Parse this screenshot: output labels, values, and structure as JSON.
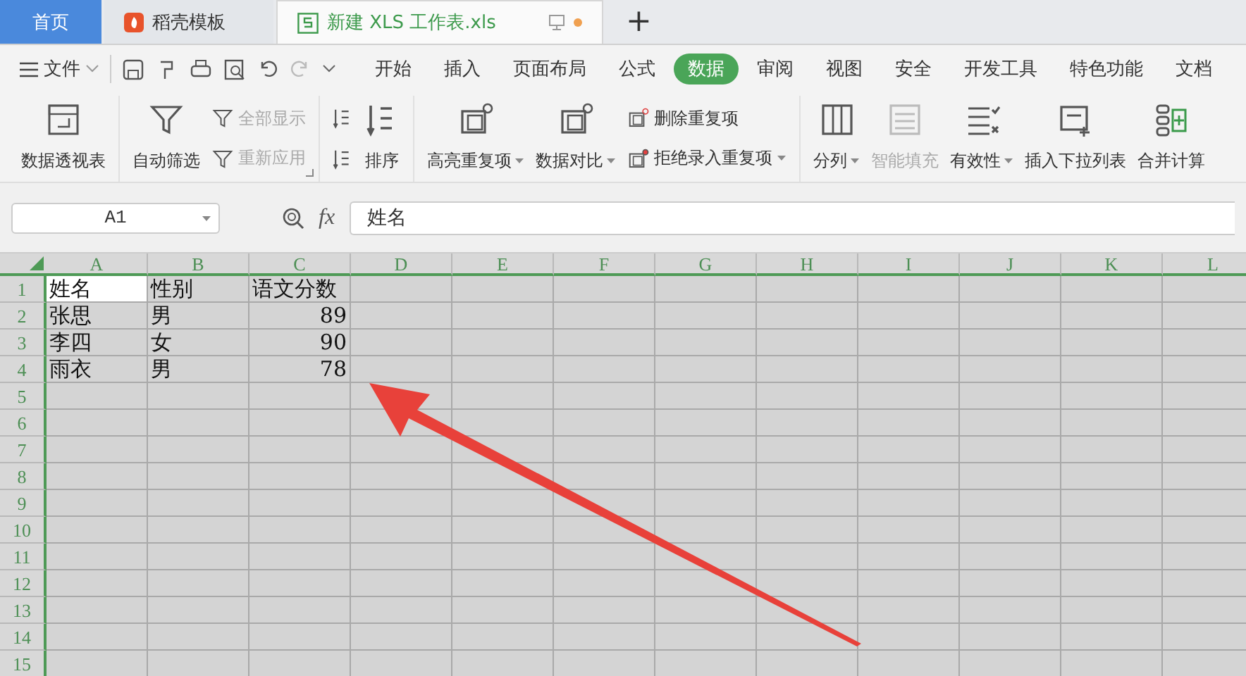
{
  "tabs": [
    {
      "label": "首页",
      "kind": "home",
      "selected": false
    },
    {
      "label": "稻壳模板",
      "kind": "app",
      "selected": false
    },
    {
      "label": "新建 XLS 工作表.xls",
      "kind": "doc",
      "selected": true,
      "unsaved": true
    }
  ],
  "new_tab_label": "+",
  "menu": {
    "file_label": "文件",
    "tabs": [
      {
        "label": "开始",
        "selected": false
      },
      {
        "label": "插入",
        "selected": false
      },
      {
        "label": "页面布局",
        "selected": false
      },
      {
        "label": "公式",
        "selected": false
      },
      {
        "label": "数据",
        "selected": true
      },
      {
        "label": "审阅",
        "selected": false
      },
      {
        "label": "视图",
        "selected": false
      },
      {
        "label": "安全",
        "selected": false
      },
      {
        "label": "开发工具",
        "selected": false
      },
      {
        "label": "特色功能",
        "selected": false
      },
      {
        "label": "文档",
        "selected": false
      }
    ]
  },
  "ribbon": {
    "groups": [
      {
        "items": [
          {
            "kind": "large",
            "label": "数据透视表",
            "disabled": false,
            "dropdown": false
          }
        ]
      },
      {
        "launcher": true,
        "items": [
          {
            "kind": "large",
            "label": "自动筛选",
            "disabled": false,
            "dropdown": false
          },
          {
            "kind": "small",
            "label": "全部显示",
            "disabled": true,
            "dropdown": false
          },
          {
            "kind": "small",
            "label": "重新应用",
            "disabled": true,
            "dropdown": false
          }
        ]
      },
      {
        "items": [
          {
            "kind": "icon",
            "disabled": false
          },
          {
            "kind": "icon",
            "disabled": false
          },
          {
            "kind": "large",
            "label": "排序",
            "disabled": false,
            "dropdown": false
          }
        ]
      },
      {
        "items": [
          {
            "kind": "large",
            "label": "高亮重复项",
            "disabled": false,
            "dropdown": true
          },
          {
            "kind": "large",
            "label": "数据对比",
            "disabled": false,
            "dropdown": true
          },
          {
            "kind": "small",
            "label": "删除重复项",
            "disabled": false,
            "dropdown": false
          },
          {
            "kind": "small",
            "label": "拒绝录入重复项",
            "disabled": false,
            "dropdown": true
          }
        ]
      },
      {
        "items": [
          {
            "kind": "large",
            "label": "分列",
            "disabled": false,
            "dropdown": true
          },
          {
            "kind": "large",
            "label": "智能填充",
            "disabled": true,
            "dropdown": false
          },
          {
            "kind": "large",
            "label": "有效性",
            "disabled": false,
            "dropdown": true
          },
          {
            "kind": "large",
            "label": "插入下拉列表",
            "disabled": false,
            "dropdown": false
          },
          {
            "kind": "large",
            "label": "合并计算",
            "disabled": false,
            "dropdown": false
          }
        ]
      }
    ]
  },
  "formula_bar": {
    "cell_ref": "A1",
    "fx_label": "fx",
    "value": "姓名"
  },
  "sheet": {
    "columns": [
      "A",
      "B",
      "C",
      "D",
      "E",
      "F",
      "G",
      "H",
      "I",
      "J",
      "K",
      "L"
    ],
    "rows": [
      {
        "number": "1",
        "cells": [
          {
            "text": "姓名",
            "kind": "text",
            "selected": true
          },
          {
            "text": "性别",
            "kind": "text",
            "selected": false
          },
          {
            "text": "语文分数",
            "kind": "text",
            "selected": false
          }
        ]
      },
      {
        "number": "2",
        "cells": [
          {
            "text": "张思",
            "kind": "text",
            "selected": false
          },
          {
            "text": "男",
            "kind": "text",
            "selected": false
          },
          {
            "text": "89",
            "kind": "number",
            "selected": false
          }
        ]
      },
      {
        "number": "3",
        "cells": [
          {
            "text": "李四",
            "kind": "text",
            "selected": false
          },
          {
            "text": "女",
            "kind": "text",
            "selected": false
          },
          {
            "text": "90",
            "kind": "number",
            "selected": false
          }
        ]
      },
      {
        "number": "4",
        "cells": [
          {
            "text": "雨衣",
            "kind": "text",
            "selected": false
          },
          {
            "text": "男",
            "kind": "text",
            "selected": false
          },
          {
            "text": "78",
            "kind": "number",
            "selected": false
          }
        ]
      },
      {
        "number": "5"
      },
      {
        "number": "6"
      },
      {
        "number": "7"
      },
      {
        "number": "8"
      },
      {
        "number": "9"
      },
      {
        "number": "10"
      },
      {
        "number": "11"
      },
      {
        "number": "12"
      },
      {
        "number": "13"
      },
      {
        "number": "14"
      },
      {
        "number": "15"
      }
    ]
  }
}
